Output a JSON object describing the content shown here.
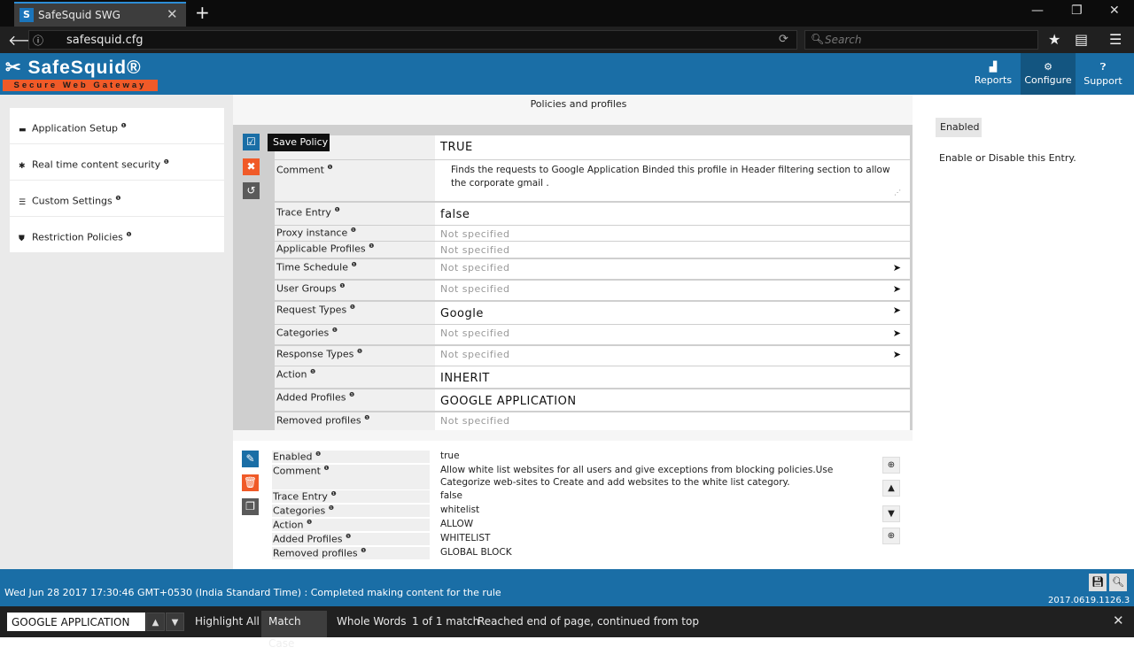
{
  "browser": {
    "tab_title": "SafeSquid SWG",
    "tab_favicon": "S",
    "url": "safesquid.cfg",
    "search_placeholder": "Search"
  },
  "app": {
    "logo_text": "SafeSquid®",
    "logo_tagline": "Secure Web Gateway",
    "nav": [
      {
        "label": "Reports",
        "icon": "chart-icon"
      },
      {
        "label": "Configure",
        "icon": "gears-icon"
      },
      {
        "label": "Support",
        "icon": "help-icon"
      }
    ],
    "colors": {
      "header": "#1a6ea6",
      "accent": "#f05a28"
    }
  },
  "sidebar": {
    "items": [
      {
        "label": "Application Setup",
        "icon": "briefcase-icon"
      },
      {
        "label": "Real time content security",
        "icon": "bug-icon"
      },
      {
        "label": "Custom Settings",
        "icon": "sliders-icon"
      },
      {
        "label": "Restriction Policies",
        "icon": "shield-icon"
      }
    ]
  },
  "main": {
    "title": "Policies and profiles",
    "tooltip": "Save Policy",
    "editor_rows": [
      {
        "label": "",
        "value": "TRUE"
      },
      {
        "label": "Comment",
        "value": "Finds the requests to Google Application Binded this profile in Header filtering section to allow the corporate gmail ."
      },
      {
        "label": "Trace Entry",
        "value": "false"
      },
      {
        "label": "Proxy instance",
        "value": "Not specified"
      },
      {
        "label": "Applicable Profiles",
        "value": "Not specified"
      },
      {
        "label": "Time Schedule",
        "value": "Not specified"
      },
      {
        "label": "User Groups",
        "value": "Not specified"
      },
      {
        "label": "Request Types",
        "value": "Google"
      },
      {
        "label": "Categories",
        "value": "Not specified"
      },
      {
        "label": "Response Types",
        "value": "Not specified"
      },
      {
        "label": "Action",
        "value": "INHERIT"
      },
      {
        "label": "Added Profiles",
        "value": "GOOGLE APPLICATION"
      },
      {
        "label": "Removed profiles",
        "value": "Not specified"
      }
    ],
    "entry_rows": [
      {
        "label": "Enabled",
        "value": "true"
      },
      {
        "label": "Comment",
        "value": "Allow white list websites for all users and give exceptions from blocking policies.Use"
      },
      {
        "label": "",
        "value": "Categorize web-sites to Create and add websites to the white list category."
      },
      {
        "label": "Trace Entry",
        "value": "false"
      },
      {
        "label": "Categories",
        "value": "whitelist"
      },
      {
        "label": "Action",
        "value": "ALLOW"
      },
      {
        "label": "Added Profiles",
        "value": "WHITELIST"
      },
      {
        "label": "Removed profiles",
        "value": "GLOBAL BLOCK"
      }
    ]
  },
  "help": {
    "tag": "Enabled",
    "text": "Enable or Disable this Entry."
  },
  "status": {
    "message": "Wed Jun 28 2017 17:30:46 GMT+0530 (India Standard Time) : Completed making content for the rule",
    "version": "2017.0619.1126.3"
  },
  "findbar": {
    "query": "GOOGLE APPLICATION",
    "highlight_all": "Highlight All",
    "match_case": "Match Case",
    "whole_words": "Whole Words",
    "count": "1 of 1 match",
    "status": "Reached end of page, continued from top"
  }
}
